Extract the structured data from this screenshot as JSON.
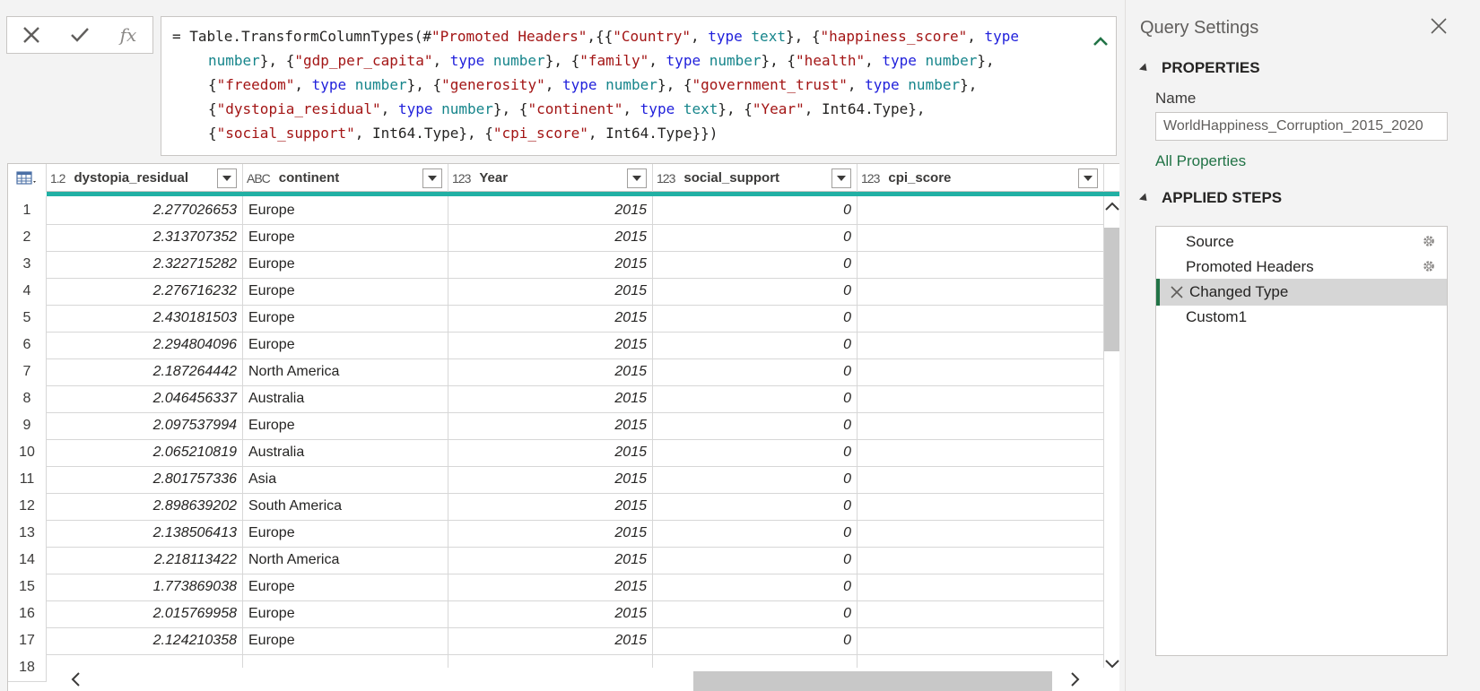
{
  "formula_bar": {
    "cancel_icon": "close-icon",
    "commit_icon": "check-icon",
    "fx_label": "fx",
    "tokens": [
      [
        [
          "p",
          "= Table.TransformColumnTypes(#"
        ],
        [
          "s",
          "\"Promoted Headers\""
        ],
        [
          "p",
          ",{{"
        ],
        [
          "s",
          "\"Country\""
        ],
        [
          "p",
          ", "
        ],
        [
          "k",
          "type"
        ],
        [
          "p",
          " "
        ],
        [
          "t",
          "text"
        ],
        [
          "p",
          "}, {"
        ],
        [
          "s",
          "\"happiness_score\""
        ],
        [
          "p",
          ", "
        ],
        [
          "k",
          "type"
        ]
      ],
      [
        [
          "t",
          "number"
        ],
        [
          "p",
          "}, {"
        ],
        [
          "s",
          "\"gdp_per_capita\""
        ],
        [
          "p",
          ", "
        ],
        [
          "k",
          "type"
        ],
        [
          "p",
          " "
        ],
        [
          "t",
          "number"
        ],
        [
          "p",
          "}, {"
        ],
        [
          "s",
          "\"family\""
        ],
        [
          "p",
          ", "
        ],
        [
          "k",
          "type"
        ],
        [
          "p",
          " "
        ],
        [
          "t",
          "number"
        ],
        [
          "p",
          "}, {"
        ],
        [
          "s",
          "\"health\""
        ],
        [
          "p",
          ", "
        ],
        [
          "k",
          "type"
        ],
        [
          "p",
          " "
        ],
        [
          "t",
          "number"
        ],
        [
          "p",
          "},"
        ]
      ],
      [
        [
          "p",
          "{"
        ],
        [
          "s",
          "\"freedom\""
        ],
        [
          "p",
          ", "
        ],
        [
          "k",
          "type"
        ],
        [
          "p",
          " "
        ],
        [
          "t",
          "number"
        ],
        [
          "p",
          "}, {"
        ],
        [
          "s",
          "\"generosity\""
        ],
        [
          "p",
          ", "
        ],
        [
          "k",
          "type"
        ],
        [
          "p",
          " "
        ],
        [
          "t",
          "number"
        ],
        [
          "p",
          "}, {"
        ],
        [
          "s",
          "\"government_trust\""
        ],
        [
          "p",
          ", "
        ],
        [
          "k",
          "type"
        ],
        [
          "p",
          " "
        ],
        [
          "t",
          "number"
        ],
        [
          "p",
          "},"
        ]
      ],
      [
        [
          "p",
          "{"
        ],
        [
          "s",
          "\"dystopia_residual\""
        ],
        [
          "p",
          ", "
        ],
        [
          "k",
          "type"
        ],
        [
          "p",
          " "
        ],
        [
          "t",
          "number"
        ],
        [
          "p",
          "}, {"
        ],
        [
          "s",
          "\"continent\""
        ],
        [
          "p",
          ", "
        ],
        [
          "k",
          "type"
        ],
        [
          "p",
          " "
        ],
        [
          "t",
          "text"
        ],
        [
          "p",
          "}, {"
        ],
        [
          "s",
          "\"Year\""
        ],
        [
          "p",
          ", Int64.Type},"
        ]
      ],
      [
        [
          "p",
          "{"
        ],
        [
          "s",
          "\"social_support\""
        ],
        [
          "p",
          ", Int64.Type}, {"
        ],
        [
          "s",
          "\"cpi_score\""
        ],
        [
          "p",
          ", Int64.Type}})"
        ]
      ]
    ]
  },
  "table": {
    "columns": [
      {
        "name": "dystopia_residual",
        "type_icon": "1.2"
      },
      {
        "name": "continent",
        "type_icon": "ABC"
      },
      {
        "name": "Year",
        "type_icon": "123"
      },
      {
        "name": "social_support",
        "type_icon": "123"
      },
      {
        "name": "cpi_score",
        "type_icon": "123"
      }
    ],
    "rows": [
      [
        "1",
        "2.277026653",
        "Europe",
        "2015",
        "0",
        ""
      ],
      [
        "2",
        "2.313707352",
        "Europe",
        "2015",
        "0",
        ""
      ],
      [
        "3",
        "2.322715282",
        "Europe",
        "2015",
        "0",
        ""
      ],
      [
        "4",
        "2.276716232",
        "Europe",
        "2015",
        "0",
        ""
      ],
      [
        "5",
        "2.430181503",
        "Europe",
        "2015",
        "0",
        ""
      ],
      [
        "6",
        "2.294804096",
        "Europe",
        "2015",
        "0",
        ""
      ],
      [
        "7",
        "2.187264442",
        "North America",
        "2015",
        "0",
        ""
      ],
      [
        "8",
        "2.046456337",
        "Australia",
        "2015",
        "0",
        ""
      ],
      [
        "9",
        "2.097537994",
        "Europe",
        "2015",
        "0",
        ""
      ],
      [
        "10",
        "2.065210819",
        "Australia",
        "2015",
        "0",
        ""
      ],
      [
        "11",
        "2.801757336",
        "Asia",
        "2015",
        "0",
        ""
      ],
      [
        "12",
        "2.898639202",
        "South America",
        "2015",
        "0",
        ""
      ],
      [
        "13",
        "2.138506413",
        "Europe",
        "2015",
        "0",
        ""
      ],
      [
        "14",
        "2.218113422",
        "North America",
        "2015",
        "0",
        ""
      ],
      [
        "15",
        "1.773869038",
        "Europe",
        "2015",
        "0",
        ""
      ],
      [
        "16",
        "2.015769958",
        "Europe",
        "2015",
        "0",
        ""
      ],
      [
        "17",
        "2.124210358",
        "Europe",
        "2015",
        "0",
        ""
      ],
      [
        "18",
        "",
        "",
        "",
        "",
        ""
      ]
    ]
  },
  "query_settings": {
    "title": "Query Settings",
    "properties_header": "PROPERTIES",
    "name_label": "Name",
    "name_value": "WorldHappiness_Corruption_2015_2020",
    "all_properties": "All Properties",
    "applied_steps_header": "APPLIED STEPS",
    "steps": [
      {
        "label": "Source",
        "has_gear": true,
        "selected": false
      },
      {
        "label": "Promoted Headers",
        "has_gear": true,
        "selected": false
      },
      {
        "label": "Changed Type",
        "has_gear": false,
        "selected": true
      },
      {
        "label": "Custom1",
        "has_gear": false,
        "selected": false
      }
    ]
  },
  "colors": {
    "accent_teal": "#21b0a4",
    "selected_step_bar": "#217346",
    "link_green": "#217346"
  }
}
